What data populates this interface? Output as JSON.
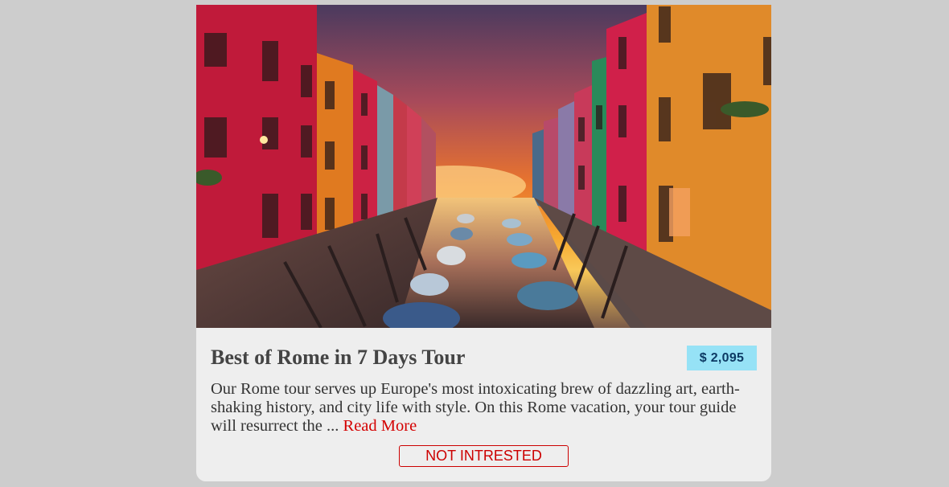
{
  "tour": {
    "title": "Best of Rome in 7 Days Tour",
    "price": "$ 2,095",
    "description": "Our Rome tour serves up Europe's most intoxicating brew of dazzling art, earth-shaking history, and city life with style. On this Rome vacation, your tour guide will resurrect the ...",
    "read_more": "Read More",
    "not_interested": "NOT INTRESTED"
  },
  "colors": {
    "page_background": "#cdcdcd",
    "card_background": "#eeeeee",
    "price_badge": "#96e2f6",
    "accent_red": "#cc0000"
  }
}
